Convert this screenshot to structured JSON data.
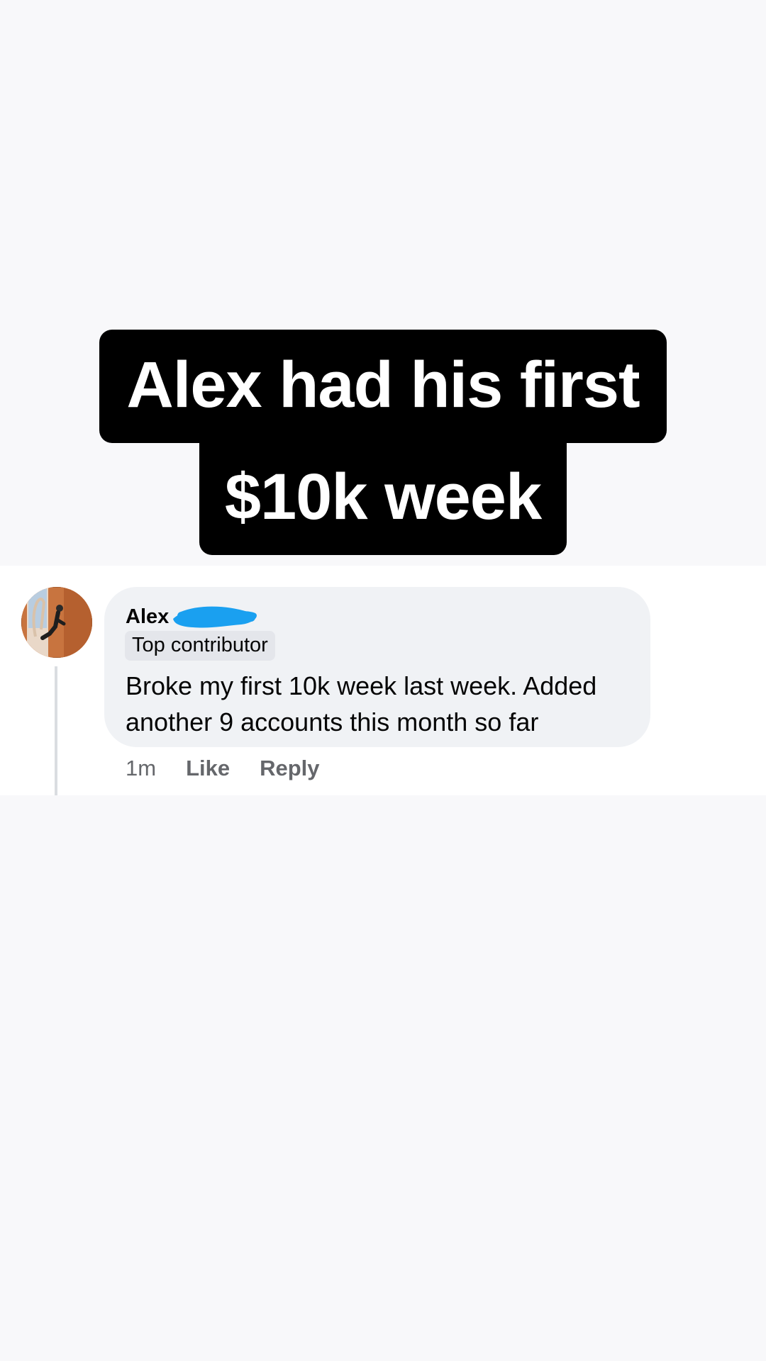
{
  "caption": {
    "line1": "Alex had his first",
    "line2": "$10k week"
  },
  "comment": {
    "author": "Alex",
    "badge": "Top contributor",
    "text": "Broke my first 10k week last week. Added another 9 accounts this month so far",
    "timestamp": "1m",
    "like_label": "Like",
    "reply_label": "Reply"
  },
  "colors": {
    "background": "#f8f8fa",
    "caption_bg": "#000000",
    "caption_text": "#ffffff",
    "bubble": "#f0f2f5",
    "badge_bg": "#e4e6eb",
    "meta_text": "#65676b",
    "redaction_mark": "#1aa0f0"
  }
}
